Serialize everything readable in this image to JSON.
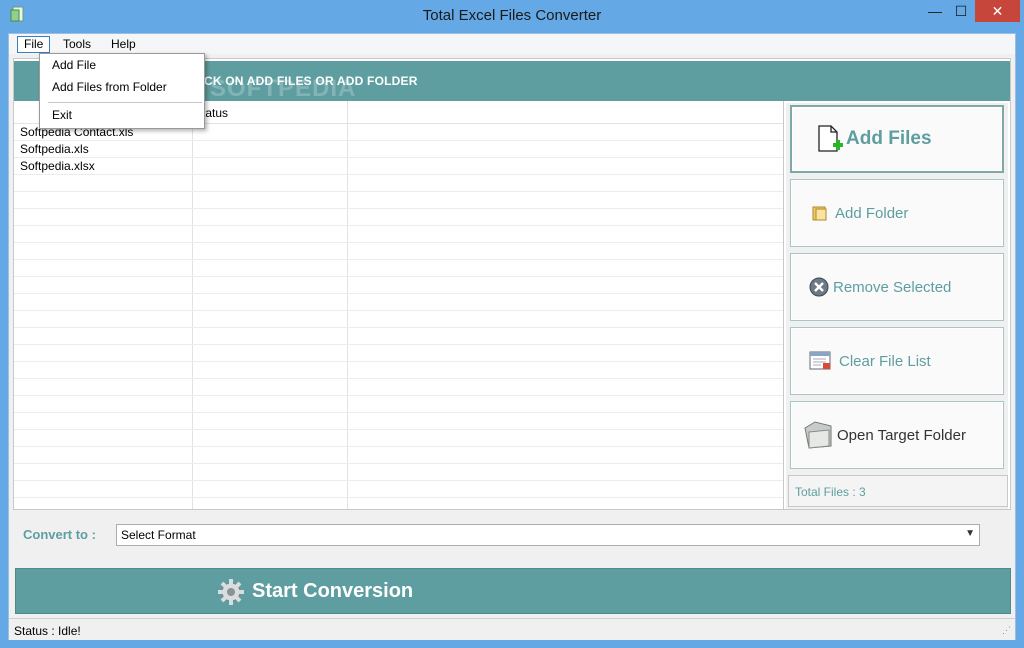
{
  "window": {
    "title": "Total Excel Files Converter",
    "minimize_glyph": "—",
    "maximize_glyph": "☐",
    "close_glyph": "✕"
  },
  "menubar": {
    "items": [
      "File",
      "Tools",
      "Help"
    ]
  },
  "file_menu": {
    "items": [
      "Add File",
      "Add Files from Folder",
      "Exit"
    ]
  },
  "banner": {
    "text": "CK ON ADD FILES OR ADD FOLDER",
    "watermark": "SOFTPEDIA"
  },
  "file_grid": {
    "columns": [
      "",
      "tatus"
    ],
    "rows": [
      {
        "name": "Softpedia Contact.xls",
        "status": ""
      },
      {
        "name": "Softpedia.xls",
        "status": ""
      },
      {
        "name": "Softpedia.xlsx",
        "status": ""
      }
    ]
  },
  "side_buttons": {
    "add_files": "Add Files",
    "add_folder": "Add Folder",
    "remove_selected": "Remove Selected",
    "clear_file_list": "Clear File List",
    "open_target_folder": "Open Target Folder"
  },
  "total_files": "Total Files : 3",
  "convert": {
    "label": "Convert to :",
    "selected": "Select Format"
  },
  "start_button": "Start Conversion",
  "status": "Status  :  Idle!",
  "colors": {
    "accent": "#5f9ea0",
    "titlebar": "#64a9e6",
    "close": "#c7463c"
  }
}
